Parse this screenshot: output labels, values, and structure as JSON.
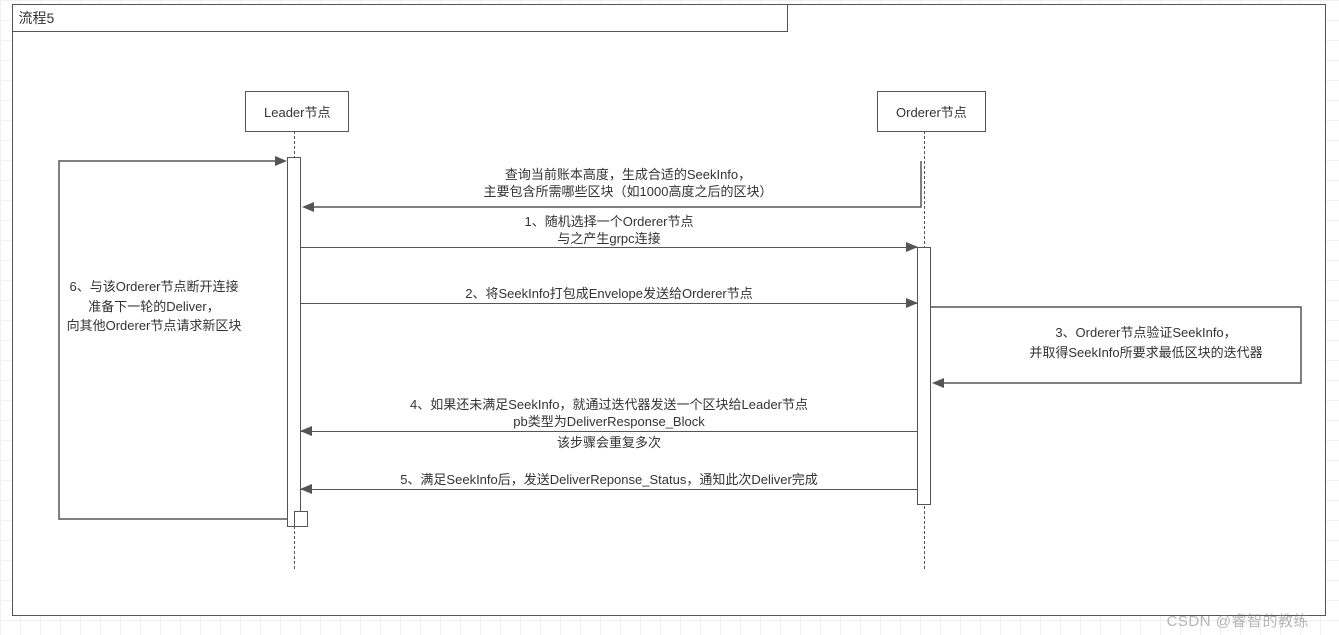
{
  "frame": {
    "title": "流程5"
  },
  "actors": {
    "leader": "Leader节点",
    "orderer": "Orderer节点"
  },
  "selfmsg": {
    "line1": "查询当前账本高度，生成合适的SeekInfo，",
    "line2": "主要包含所需哪些区块（如1000高度之后的区块）"
  },
  "msg1": {
    "line1": "1、随机选择一个Orderer节点",
    "line2": "与之产生grpc连接"
  },
  "msg2": {
    "text": "2、将SeekInfo打包成Envelope发送给Orderer节点"
  },
  "msg3": {
    "line1": "3、Orderer节点验证SeekInfo，",
    "line2": "并取得SeekInfo所要求最低区块的迭代器"
  },
  "msg4": {
    "line1": "4、如果还未满足SeekInfo，就通过迭代器发送一个区块给Leader节点",
    "line2": "pb类型为DeliverResponse_Block",
    "line3": "该步骤会重复多次"
  },
  "msg5": {
    "text": "5、满足SeekInfo后，发送DeliverReponse_Status，通知此次Deliver完成"
  },
  "msg6": {
    "line1": "6、与该Orderer节点断开连接",
    "line2": "准备下一轮的Deliver，",
    "line3": "向其他Orderer节点请求新区块"
  },
  "watermark": "CSDN @睿智的教练"
}
